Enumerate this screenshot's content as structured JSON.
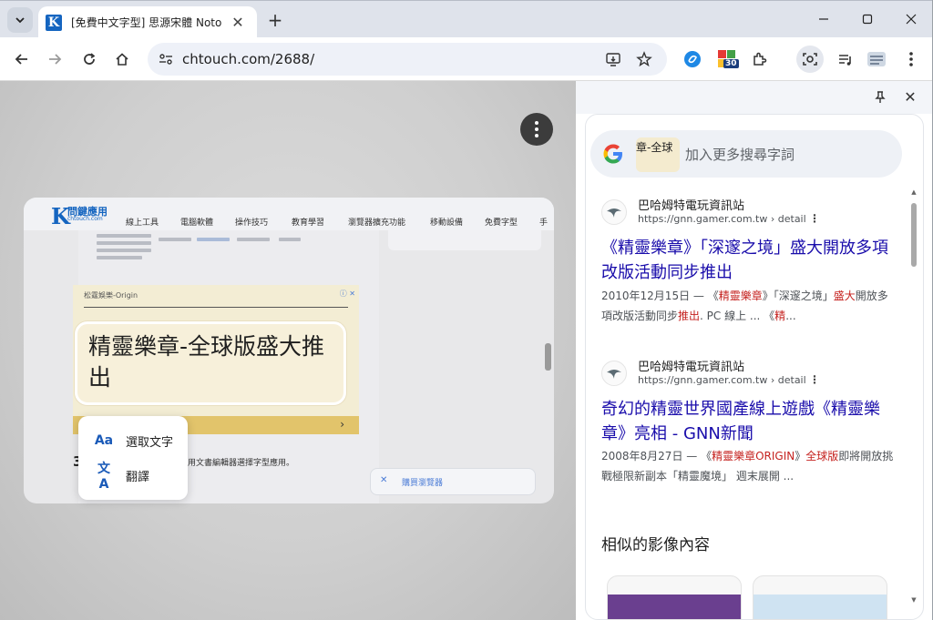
{
  "tab": {
    "title": "[免費中文字型] 思源宋體 Noto",
    "favicon_letter": "K"
  },
  "toolbar": {
    "url": "chtouch.com/2688/"
  },
  "badge_count": "30",
  "page_shot": {
    "logo_letter": "K",
    "logo_text": "問鍵應用",
    "logo_sub": "chtouch.com",
    "nav": [
      "線上工具",
      "電腦軟體",
      "操作技巧",
      "教育學習",
      "瀏覽器擴充功能",
      "移動設備",
      "免費字型",
      "手"
    ],
    "ad_label": "松霆娛樂-Origin",
    "ad_close": "ⓘ ✕",
    "selected_text": "精靈樂章-全球版盛大推出",
    "para_num": "3",
    "para_text": "用文書編輯器選擇字型應用。",
    "bottom_bar_text": "購買瀏覽器",
    "bottom_bar_x": "✕"
  },
  "context_menu": {
    "items": [
      {
        "icon": "Aa",
        "label": "選取文字"
      },
      {
        "icon": "文A",
        "label": "翻譯"
      }
    ]
  },
  "side_panel": {
    "crop_text": "章-全球",
    "search_placeholder": "加入更多搜尋字詞",
    "results": [
      {
        "site": "巴哈姆特電玩資訊站",
        "url": "https://gnn.gamer.com.tw › detail",
        "title": "《精靈樂章》「深邃之境」盛大開放多項改版活動同步推出",
        "snippet_parts": [
          {
            "t": "2010年12月15日 — 《",
            "h": false
          },
          {
            "t": "精靈樂章",
            "h": true
          },
          {
            "t": "》「深邃之境」",
            "h": false
          },
          {
            "t": "盛大",
            "h": true
          },
          {
            "t": "開放多項改版活動同步",
            "h": false
          },
          {
            "t": "推出",
            "h": true
          },
          {
            "t": ". PC 線上 ... 《",
            "h": false
          },
          {
            "t": "精",
            "h": true
          },
          {
            "t": "...",
            "h": false
          }
        ]
      },
      {
        "site": "巴哈姆特電玩資訊站",
        "url": "https://gnn.gamer.com.tw › detail",
        "title": "奇幻的精靈世界國產線上遊戲《精靈樂章》亮相 - GNN新聞",
        "snippet_parts": [
          {
            "t": "2008年8月27日 — 《",
            "h": false
          },
          {
            "t": "精靈樂章ORIGIN",
            "h": true
          },
          {
            "t": "》",
            "h": false
          },
          {
            "t": "全球版",
            "h": true
          },
          {
            "t": "即將開放挑戰極限新副本「精靈魔境」 週末展開 ...",
            "h": false
          }
        ]
      }
    ],
    "similar_heading": "相似的影像內容"
  },
  "colors": {
    "link": "#1a0dab",
    "highlight": "#c5221f",
    "accent": "#1a5ab8"
  }
}
